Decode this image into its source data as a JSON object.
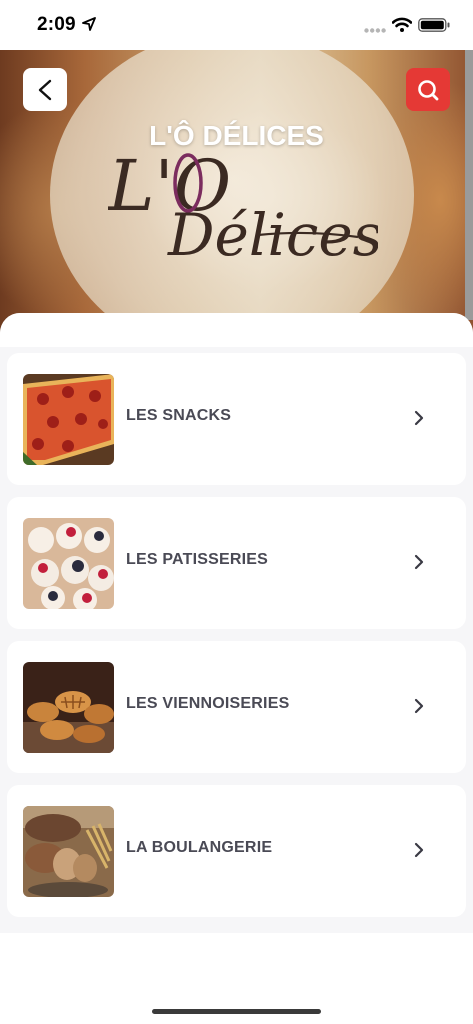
{
  "status_bar": {
    "time": "2:09",
    "icons": [
      "location-arrow-icon",
      "signal-dots-icon",
      "wifi-icon",
      "battery-icon"
    ]
  },
  "header": {
    "title": "L'Ô DÉLICES",
    "logo_text_primary": "L'O",
    "logo_text_secondary": "Délices",
    "back_icon": "chevron-left-icon",
    "search_icon": "search-icon",
    "accent_color": "#e53935"
  },
  "categories": [
    {
      "label": "LES SNACKS",
      "image": "pizza-photo",
      "chevron": "chevron-right-icon"
    },
    {
      "label": "LES PATISSERIES",
      "image": "pastries-photo",
      "chevron": "chevron-right-icon"
    },
    {
      "label": "LES VIENNOISERIES",
      "image": "croissants-photo",
      "chevron": "chevron-right-icon"
    },
    {
      "label": "LA BOULANGERIE",
      "image": "bread-photo",
      "chevron": "chevron-right-icon"
    }
  ]
}
